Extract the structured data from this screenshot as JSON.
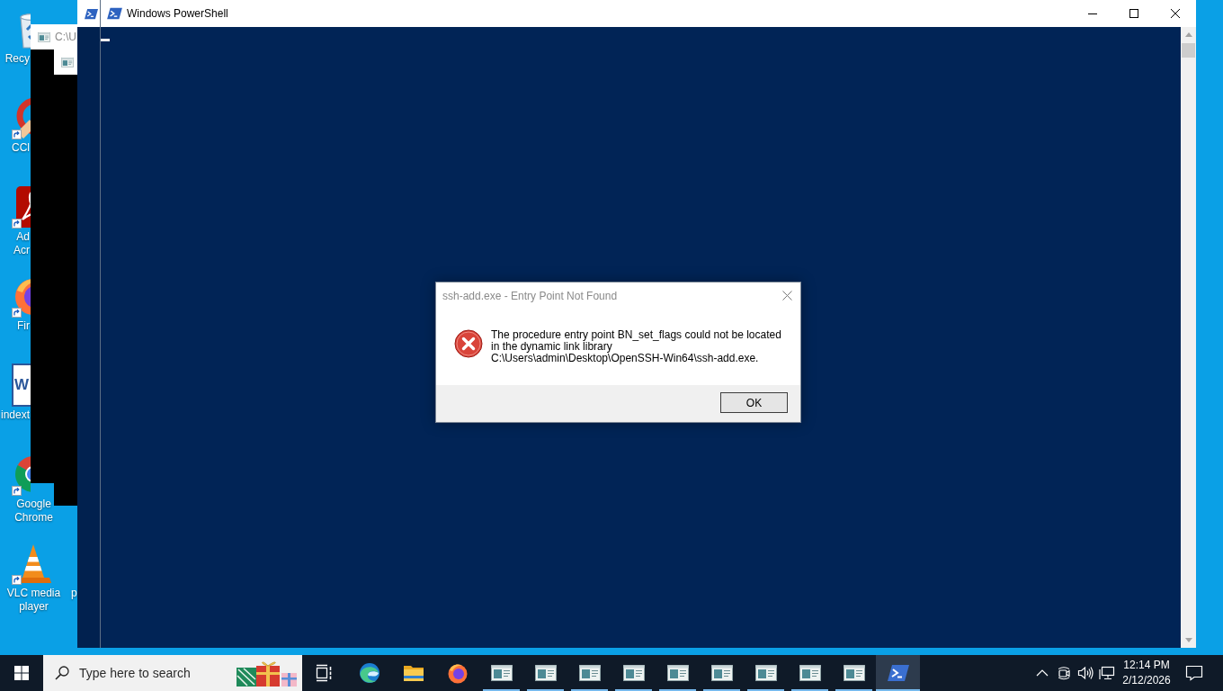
{
  "desktop": {
    "icons": [
      {
        "kind": "recycle-bin",
        "label": "Recy",
        "shortcut": false
      },
      {
        "kind": "cleaner",
        "label": "CCl",
        "shortcut": true
      },
      {
        "kind": "pdf-reader",
        "label": "Ad Acr",
        "shortcut": true
      },
      {
        "kind": "firefox",
        "label": "Fir",
        "shortcut": true
      },
      {
        "kind": "word-document",
        "label": "indext",
        "shortcut": false,
        "logo_letter": "W"
      },
      {
        "kind": "chrome",
        "label": "Google Chrome",
        "shortcut": true
      },
      {
        "kind": "vlc",
        "label": "VLC media player",
        "shortcut": true
      }
    ],
    "second_column_labels": [
      "p"
    ]
  },
  "background_windows": [
    {
      "kind": "console",
      "title": "C:\\U"
    },
    {
      "kind": "console"
    },
    {
      "kind": "powershell"
    }
  ],
  "powershell_window": {
    "title": "Windows PowerShell",
    "active": true
  },
  "dialog": {
    "title": "ssh-add.exe - Entry Point Not Found",
    "active": false,
    "message": "The procedure entry point BN_set_flags could not be located in the dynamic link library C:\\Users\\admin\\Desktop\\OpenSSH-Win64\\ssh-add.exe.",
    "buttons": [
      "OK"
    ]
  },
  "taskbar": {
    "search": {
      "placeholder": "Type here to search"
    },
    "pinned": [
      {
        "kind": "task-view"
      },
      {
        "kind": "edge"
      },
      {
        "kind": "explorer"
      },
      {
        "kind": "firefox"
      }
    ],
    "window_buttons": [
      {
        "kind": "console",
        "selected": false
      },
      {
        "kind": "console",
        "selected": false
      },
      {
        "kind": "console",
        "selected": false
      },
      {
        "kind": "console",
        "selected": false
      },
      {
        "kind": "console",
        "selected": false
      },
      {
        "kind": "console",
        "selected": false
      },
      {
        "kind": "console",
        "selected": false
      },
      {
        "kind": "console",
        "selected": false
      },
      {
        "kind": "console",
        "selected": false
      },
      {
        "kind": "powershell",
        "selected": true
      }
    ],
    "clock": {
      "time": "12:14 PM",
      "date": "2/12/2026"
    }
  }
}
